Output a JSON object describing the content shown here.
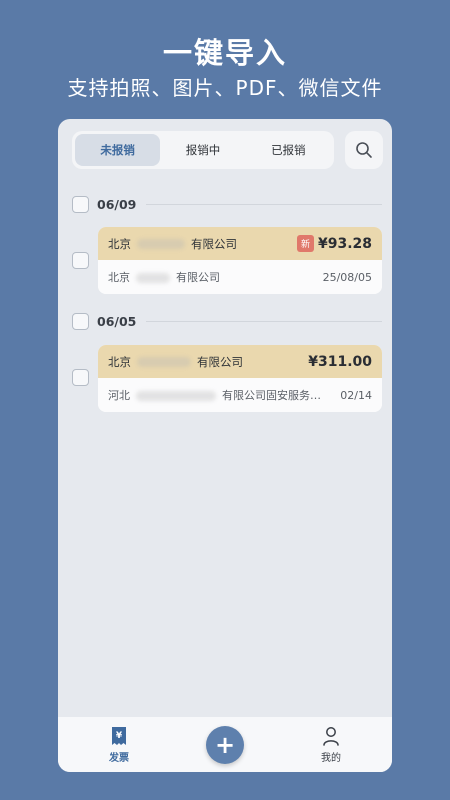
{
  "promo": {
    "headline": "一键导入",
    "subline": "支持拍照、图片、PDF、微信文件"
  },
  "tabs": [
    {
      "label": "未报销",
      "active": true
    },
    {
      "label": "报销中",
      "active": false
    },
    {
      "label": "已报销",
      "active": false
    }
  ],
  "groups": [
    {
      "date": "06/09",
      "invoices": [
        {
          "seller_prefix": "北京",
          "seller_suffix": "有限公司",
          "badge": "新",
          "amount": "¥93.28",
          "buyer_prefix": "北京",
          "buyer_suffix": "有限公司",
          "date": "25/08/05"
        }
      ]
    },
    {
      "date": "06/05",
      "invoices": [
        {
          "seller_prefix": "北京",
          "seller_suffix": "有限公司",
          "amount": "¥311.00",
          "buyer_prefix": "河北",
          "buyer_suffix": "有限公司固安服务…",
          "date": "02/14"
        }
      ]
    }
  ],
  "bottom_nav": {
    "invoice_label": "发票",
    "invoice_icon_glyph": "¥",
    "add_glyph": "+",
    "mine_label": "我的"
  },
  "colors": {
    "background": "#5a7aa7",
    "accent": "#3f6a9e",
    "card_header": "#ead8ae",
    "badge": "#e0786a"
  },
  "icons": {
    "search": "search-icon",
    "invoice": "invoice-icon",
    "add": "plus-icon",
    "mine": "user-icon"
  }
}
